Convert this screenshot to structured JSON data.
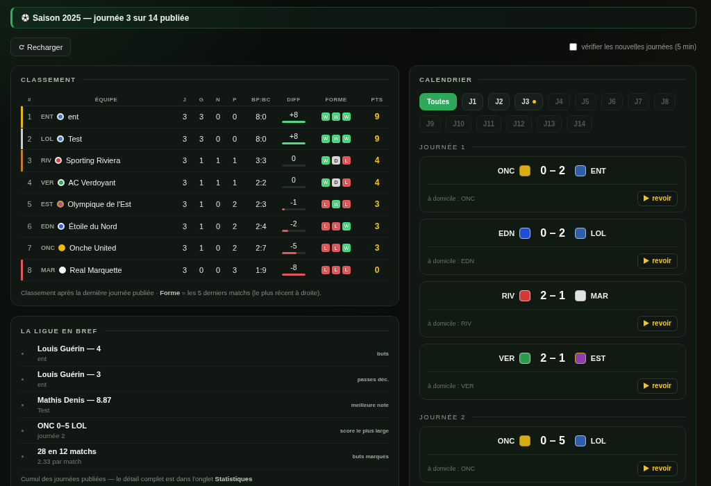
{
  "banner": {
    "title": "Saison 2025 — journée 3 sur 14 publiée"
  },
  "toolbar": {
    "reload_button": "Recharger",
    "auto_refresh": {
      "label": "vérifier les nouvelles journées (5 min)",
      "checked": false
    }
  },
  "standings": {
    "title": "CLASSEMENT",
    "columns": [
      "#",
      "ÉQUIPE",
      "J",
      "G",
      "N",
      "P",
      "BP:BC",
      "DIFF",
      "FORME",
      "PTS"
    ],
    "rows": [
      {
        "rank": "1",
        "code": "ENT",
        "color": "#4a78c8",
        "ring": {
          "color": "#e6ecf2"
        },
        "team": "ent",
        "played": "3",
        "won": "3",
        "drawn": "0",
        "lost": "0",
        "goals": "8:0",
        "diff": "+8",
        "diff_bar": {
          "level": 1,
          "negative": false
        },
        "form": [
          {
            "label": "W",
            "kind": "win"
          },
          {
            "label": "W",
            "kind": "win"
          },
          {
            "label": "W",
            "kind": "win"
          }
        ],
        "points": "9",
        "stripe": {
          "color": "#e8b90c"
        }
      },
      {
        "rank": "2",
        "code": "LOL",
        "color": "#4a78c8",
        "ring": {
          "color": "#e6ecf2"
        },
        "team": "Test",
        "played": "3",
        "won": "3",
        "drawn": "0",
        "lost": "0",
        "goals": "8:0",
        "diff": "+8",
        "diff_bar": {
          "level": 1,
          "negative": false
        },
        "form": [
          {
            "label": "W",
            "kind": "win"
          },
          {
            "label": "W",
            "kind": "win"
          },
          {
            "label": "W",
            "kind": "win"
          }
        ],
        "points": "9",
        "stripe": {
          "color": "#c8cccb"
        }
      },
      {
        "rank": "3",
        "code": "RIV",
        "color": "#e23b3b",
        "ring": {
          "color": "#e6ecf2"
        },
        "team": "Sporting Riviera",
        "played": "3",
        "won": "1",
        "drawn": "1",
        "lost": "1",
        "goals": "3:3",
        "diff": "0",
        "diff_bar": {
          "level": 0
        },
        "form": [
          {
            "label": "W",
            "kind": "win"
          },
          {
            "label": "D",
            "kind": "draw"
          },
          {
            "label": "L",
            "kind": "loss"
          }
        ],
        "points": "4",
        "stripe": {
          "color": "#c87a22"
        }
      },
      {
        "rank": "4",
        "code": "VER",
        "color": "#3aa655",
        "ring": {
          "color": "#e6ecf2"
        },
        "team": "AC Verdoyant",
        "played": "3",
        "won": "1",
        "drawn": "1",
        "lost": "1",
        "goals": "2:2",
        "diff": "0",
        "diff_bar": {
          "level": 0
        },
        "form": [
          {
            "label": "W",
            "kind": "win"
          },
          {
            "label": "D",
            "kind": "draw"
          },
          {
            "label": "L",
            "kind": "loss"
          }
        ],
        "points": "4"
      },
      {
        "rank": "5",
        "code": "EST",
        "color": "#9b4fc0",
        "ring": {
          "color": "#d4a017"
        },
        "team": "Olympique de l'Est",
        "played": "3",
        "won": "1",
        "drawn": "0",
        "lost": "2",
        "goals": "2:3",
        "diff": "-1",
        "diff_bar": {
          "level": 0.12,
          "negative": true
        },
        "form": [
          {
            "label": "L",
            "kind": "loss"
          },
          {
            "label": "W",
            "kind": "win"
          },
          {
            "label": "L",
            "kind": "loss"
          }
        ],
        "points": "3"
      },
      {
        "rank": "6",
        "code": "EDN",
        "color": "#2f66e8",
        "ring": {
          "color": "#e6ecf2"
        },
        "team": "Étoile du Nord",
        "played": "3",
        "won": "1",
        "drawn": "0",
        "lost": "2",
        "goals": "2:4",
        "diff": "-2",
        "diff_bar": {
          "level": 0.25,
          "negative": true
        },
        "form": [
          {
            "label": "L",
            "kind": "loss"
          },
          {
            "label": "L",
            "kind": "loss"
          },
          {
            "label": "W",
            "kind": "win"
          }
        ],
        "points": "3"
      },
      {
        "rank": "7",
        "code": "ONC",
        "color": "#e8b90c",
        "ring": {
          "color": "#e8b90c"
        },
        "team": "Onche United",
        "played": "3",
        "won": "1",
        "drawn": "0",
        "lost": "2",
        "goals": "2:7",
        "diff": "-5",
        "diff_bar": {
          "level": 0.62,
          "negative": true
        },
        "form": [
          {
            "label": "L",
            "kind": "loss"
          },
          {
            "label": "L",
            "kind": "loss"
          },
          {
            "label": "W",
            "kind": "win"
          }
        ],
        "points": "3"
      },
      {
        "rank": "8",
        "code": "MAR",
        "color": "#f5f5f5",
        "ring": {
          "color": "#f5f5f5"
        },
        "team": "Real Marquette",
        "played": "3",
        "won": "0",
        "drawn": "0",
        "lost": "3",
        "goals": "1:9",
        "diff": "-8",
        "diff_bar": {
          "level": 1,
          "negative": true
        },
        "form": [
          {
            "label": "L",
            "kind": "loss"
          },
          {
            "label": "L",
            "kind": "loss"
          },
          {
            "label": "L",
            "kind": "loss"
          }
        ],
        "points": "0",
        "stripe": {
          "color": "#e05555"
        }
      }
    ],
    "note": "Classement après la dernière journée publiée · **Forme** = les 5 derniers matchs (le plus récent à droite)."
  },
  "summary": {
    "title": "LA LIGUE EN BREF",
    "items": [
      {
        "value": "Louis Guérin — 4",
        "detail": "ent",
        "label": "buts"
      },
      {
        "value": "Louis Guérin — 3",
        "detail": "ent",
        "label": "passes déc."
      },
      {
        "value": "Mathis Denis — 8.87",
        "detail": "Test",
        "label": "meilleure note"
      },
      {
        "value": "ONC 0–5 LOL",
        "detail": "journée 2",
        "label": "score le plus large"
      },
      {
        "value": "28 en 12 matchs",
        "detail": "2.33 par match",
        "label": "buts marqués"
      }
    ],
    "note": "Cumul des journées publiées — le détail complet est dans l'onglet **Statistiques**"
  },
  "calendar": {
    "title": "CALENDRIER",
    "filters": [
      {
        "label": "Toutes",
        "selected": true,
        "disabled": false,
        "current": false
      },
      {
        "label": "J1",
        "selected": false,
        "disabled": false,
        "current": false
      },
      {
        "label": "J2",
        "selected": false,
        "disabled": false,
        "current": false
      },
      {
        "label": "J3",
        "selected": false,
        "disabled": false,
        "current": true
      },
      {
        "label": "J4",
        "selected": false,
        "disabled": true,
        "current": false
      },
      {
        "label": "J5",
        "selected": false,
        "disabled": true,
        "current": false
      },
      {
        "label": "J6",
        "selected": false,
        "disabled": true,
        "current": false
      },
      {
        "label": "J7",
        "selected": false,
        "disabled": true,
        "current": false
      },
      {
        "label": "J8",
        "selected": false,
        "disabled": true,
        "current": false
      },
      {
        "label": "J9",
        "selected": false,
        "disabled": true,
        "current": false
      },
      {
        "label": "J10",
        "selected": false,
        "disabled": true,
        "current": false
      },
      {
        "label": "J11",
        "selected": false,
        "disabled": true,
        "current": false
      },
      {
        "label": "J12",
        "selected": false,
        "disabled": true,
        "current": false
      },
      {
        "label": "J13",
        "selected": false,
        "disabled": true,
        "current": false
      },
      {
        "label": "J14",
        "selected": false,
        "disabled": true,
        "current": false
      }
    ],
    "rounds": [
      {
        "title": "JOURNÉE 1",
        "matches": [
          {
            "home": {
              "code": "ONC",
              "color": "#d8ad14",
              "ring": {
                "color": "#a8870e"
              }
            },
            "score": "0 – 2",
            "away": {
              "code": "ENT",
              "color": "#2f5fa8",
              "ring": {
                "color": "#9fb4d6"
              }
            },
            "venue": "à domicile : ONC",
            "action": "revoir"
          },
          {
            "home": {
              "code": "EDN",
              "color": "#1f4fd8",
              "ring": {
                "color": "#a9bbe6"
              }
            },
            "score": "0 – 2",
            "away": {
              "code": "LOL",
              "color": "#2f5fa8",
              "ring": {
                "color": "#9fb4d6"
              }
            },
            "venue": "à domicile : EDN",
            "action": "revoir"
          },
          {
            "home": {
              "code": "RIV",
              "color": "#d93636",
              "ring": {
                "color": "#e6b0b0"
              }
            },
            "score": "2 – 1",
            "away": {
              "code": "MAR",
              "color": "#e2e2e2",
              "ring": {
                "color": "#b8b8b8"
              }
            },
            "venue": "à domicile : RIV",
            "action": "revoir"
          },
          {
            "home": {
              "code": "VER",
              "color": "#2e9a4e",
              "ring": {
                "color": "#9fd0ae"
              }
            },
            "score": "2 – 1",
            "away": {
              "code": "EST",
              "color": "#8a3fb0",
              "ring": {
                "color": "#c9a227"
              }
            },
            "venue": "à domicile : VER",
            "action": "revoir"
          }
        ]
      },
      {
        "title": "JOURNÉE 2",
        "matches": [
          {
            "home": {
              "code": "ONC",
              "color": "#d8ad14",
              "ring": {
                "color": "#a8870e"
              }
            },
            "score": "0 – 5",
            "away": {
              "code": "LOL",
              "color": "#2f5fa8",
              "ring": {
                "color": "#9fb4d6"
              }
            },
            "venue": "à domicile : ONC",
            "action": "revoir"
          }
        ]
      }
    ]
  }
}
